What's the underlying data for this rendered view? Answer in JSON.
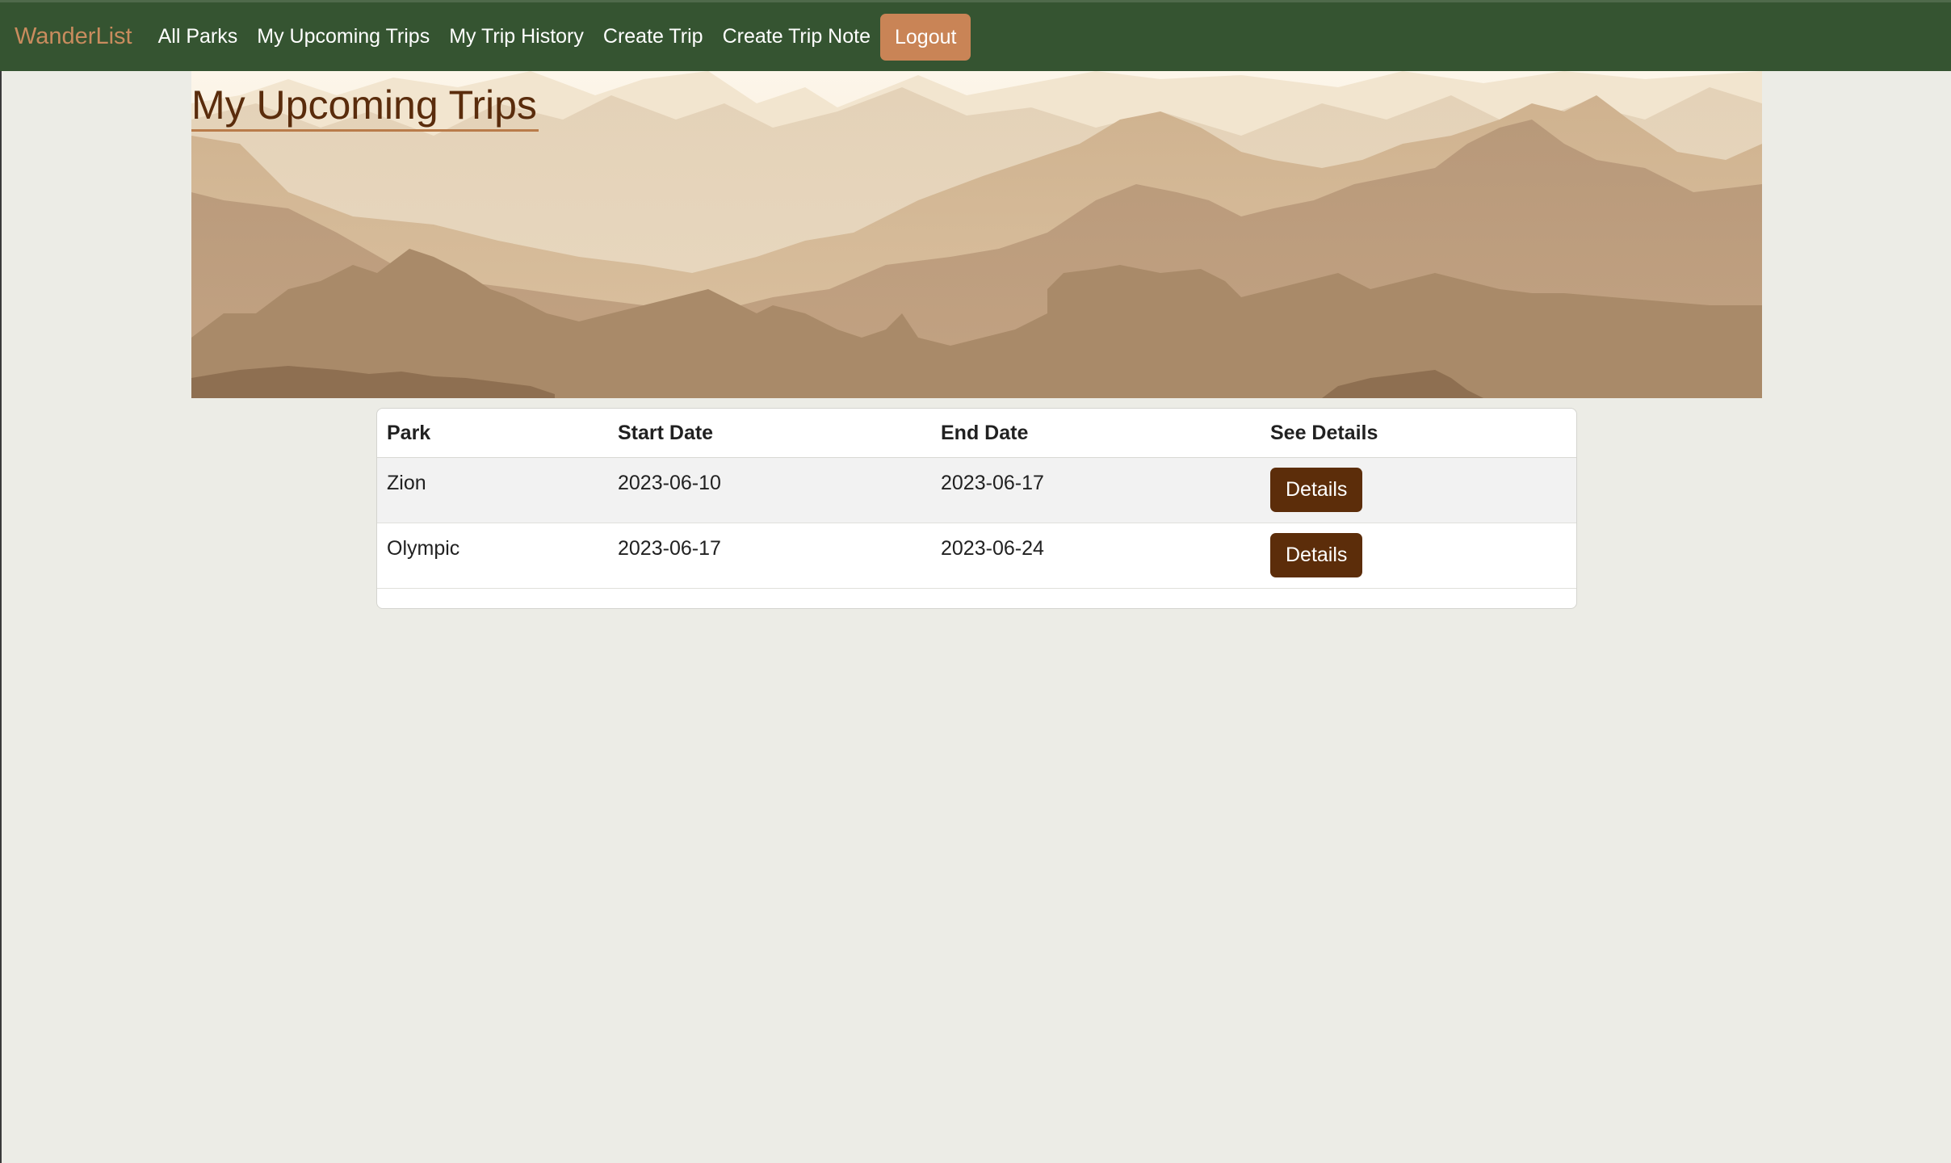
{
  "navbar": {
    "brand": "WanderList",
    "links": [
      {
        "label": "All Parks"
      },
      {
        "label": "My Upcoming Trips"
      },
      {
        "label": "My Trip History"
      },
      {
        "label": "Create Trip"
      },
      {
        "label": "Create Trip Note"
      }
    ],
    "logout_label": "Logout"
  },
  "page": {
    "title": "My Upcoming Trips"
  },
  "table": {
    "headers": {
      "park": "Park",
      "start_date": "Start Date",
      "end_date": "End Date",
      "see_details": "See Details"
    },
    "rows": [
      {
        "park": "Zion",
        "start_date": "2023-06-10",
        "end_date": "2023-06-17",
        "button": "Details"
      },
      {
        "park": "Olympic",
        "start_date": "2023-06-17",
        "end_date": "2023-06-24",
        "button": "Details"
      }
    ]
  },
  "colors": {
    "navbar_bg": "#355431",
    "brand": "#c98c5e",
    "logout_bg": "#c98456",
    "details_bg": "#5c2d0a",
    "title": "#5a2c0c",
    "page_bg": "#ecece6"
  }
}
